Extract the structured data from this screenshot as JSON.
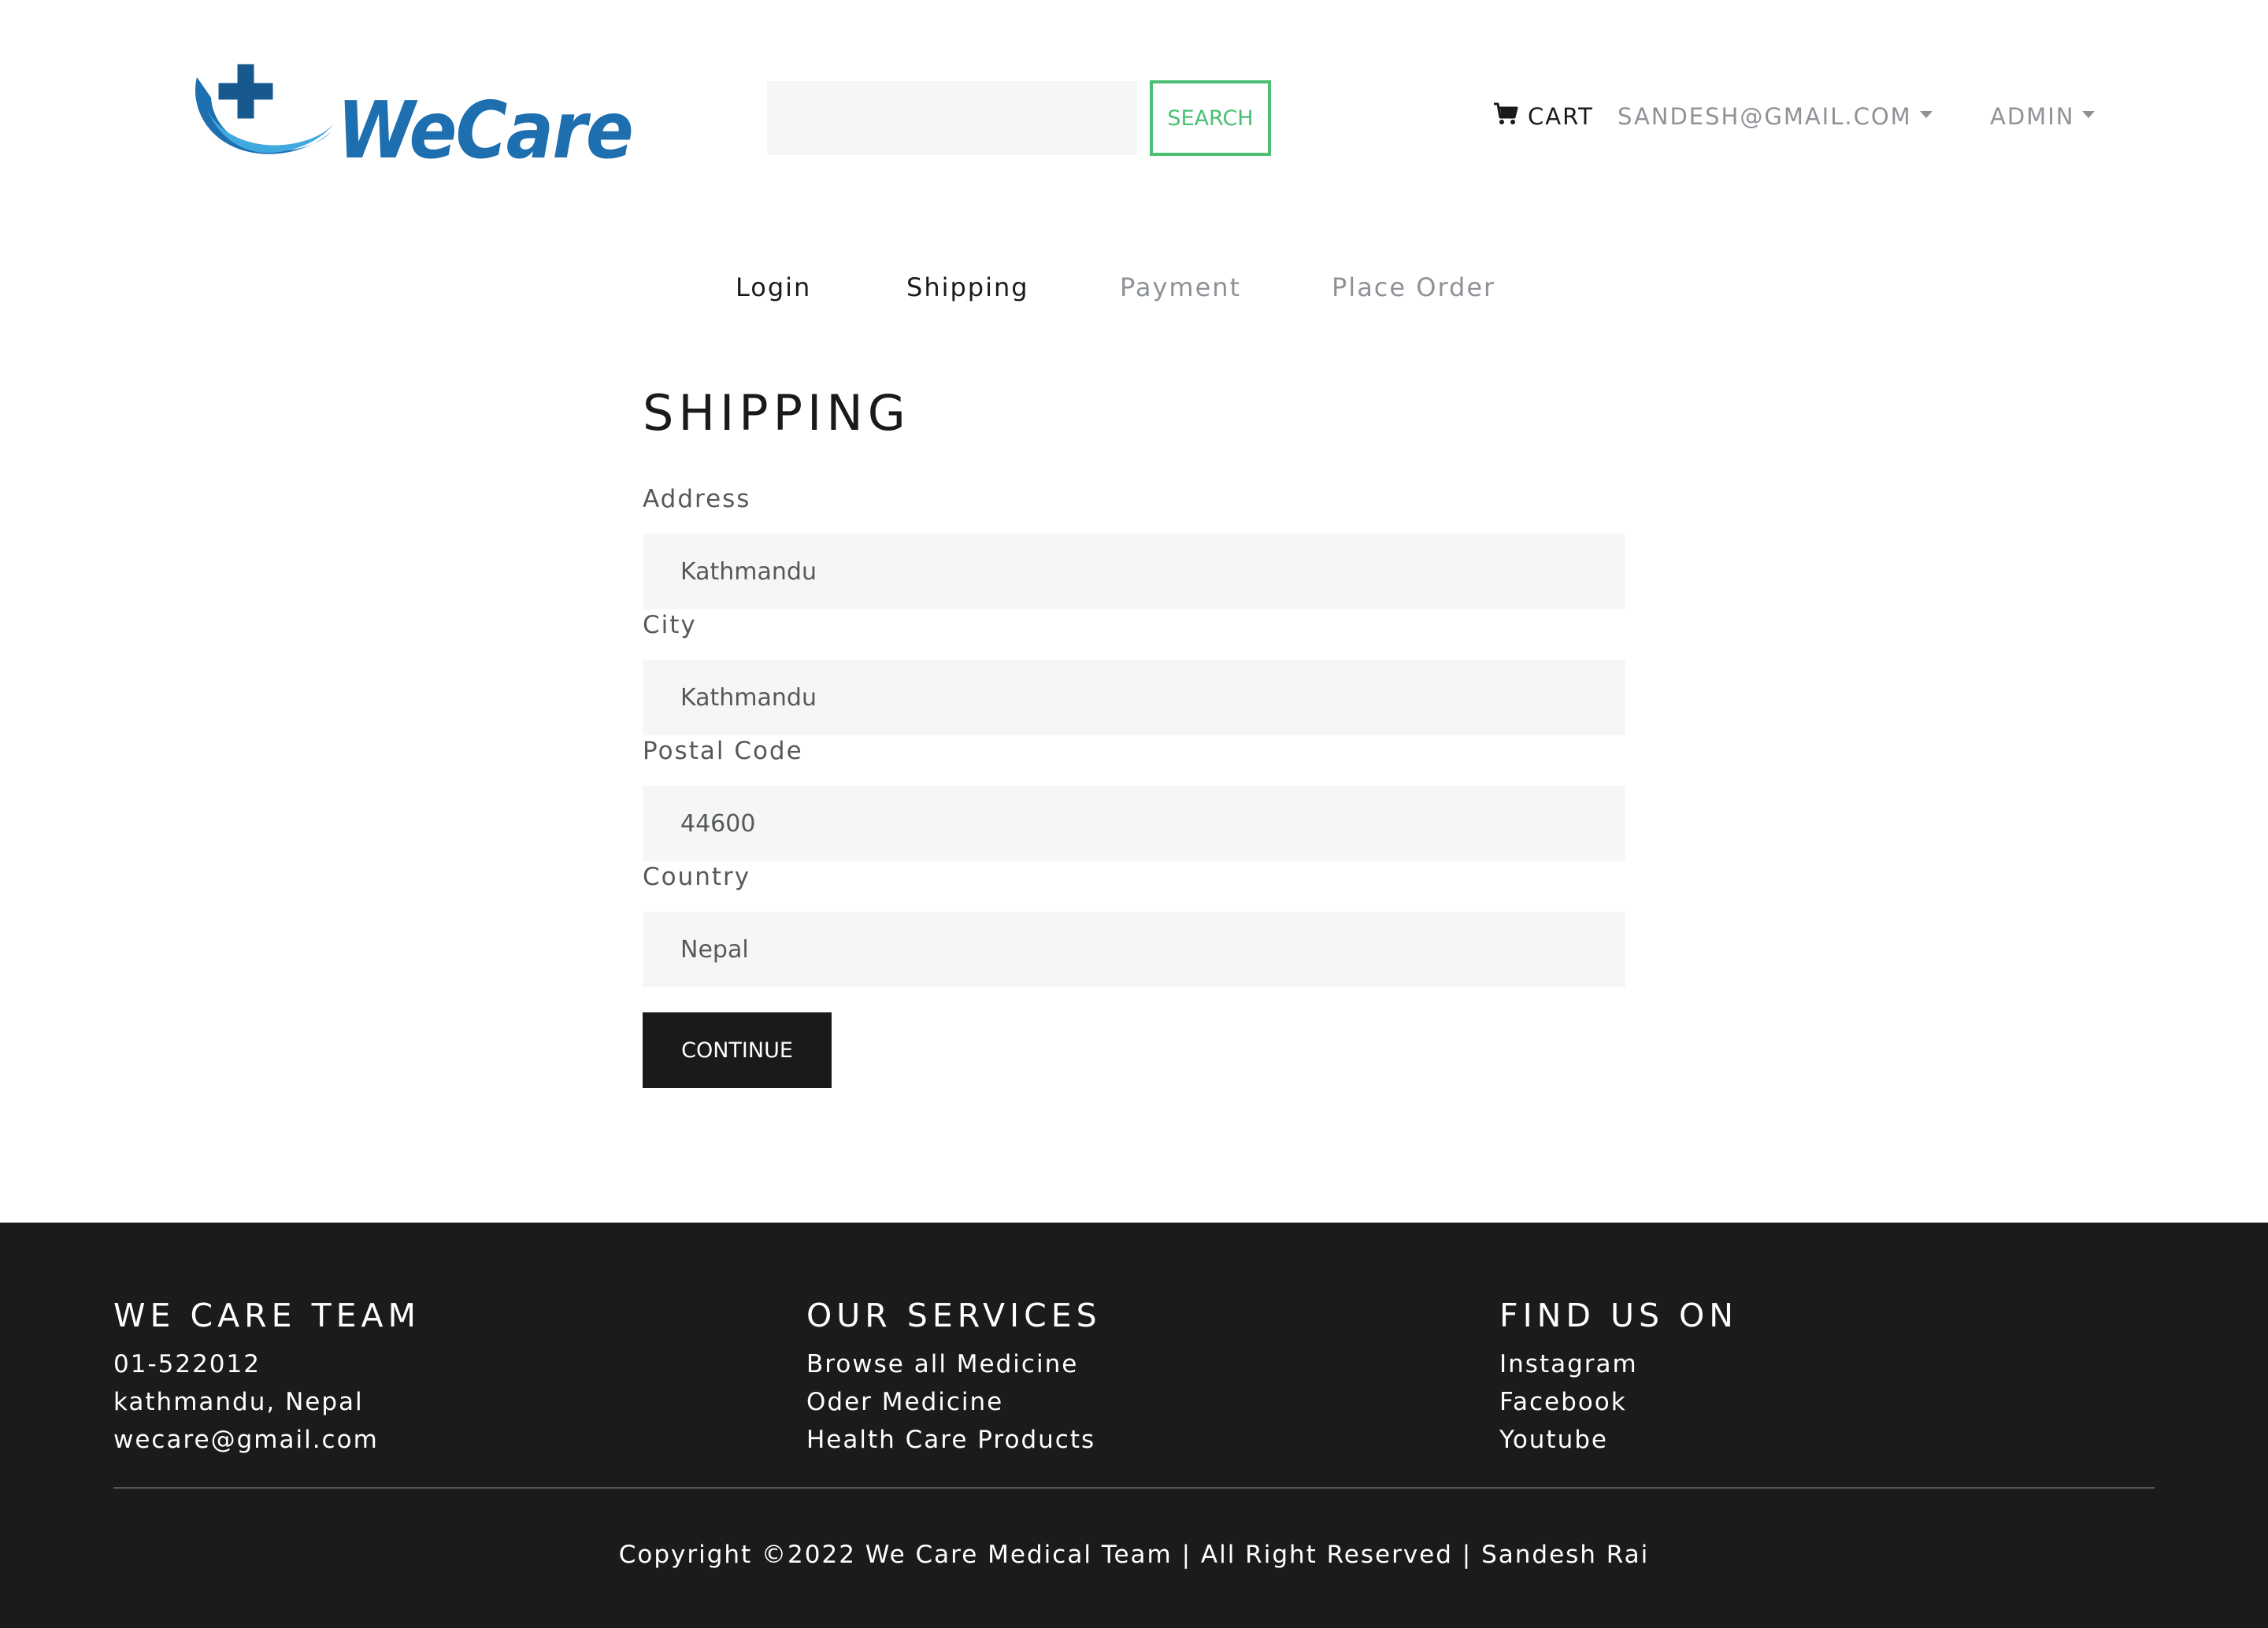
{
  "header": {
    "logo_text": "WeCare",
    "search": {
      "placeholder": "",
      "value": "",
      "button_label": "SEARCH"
    },
    "nav": {
      "cart_label": "CART",
      "user_label": "SANDESH@GMAIL.COM",
      "admin_label": "ADMIN"
    }
  },
  "steps": [
    {
      "label": "Login",
      "state": "active"
    },
    {
      "label": "Shipping",
      "state": "active"
    },
    {
      "label": "Payment",
      "state": "disabled"
    },
    {
      "label": "Place Order",
      "state": "disabled"
    }
  ],
  "form": {
    "title": "SHIPPING",
    "fields": [
      {
        "label": "Address",
        "value": "Kathmandu"
      },
      {
        "label": "City",
        "value": "Kathmandu"
      },
      {
        "label": "Postal Code",
        "value": "44600"
      },
      {
        "label": "Country",
        "value": "Nepal"
      }
    ],
    "submit_label": "CONTINUE"
  },
  "footer": {
    "columns": [
      {
        "heading": "WE CARE TEAM",
        "lines": [
          "01-522012",
          "kathmandu, Nepal",
          "wecare@gmail.com"
        ]
      },
      {
        "heading": "OUR SERVICES",
        "lines": [
          "Browse all Medicine",
          "Oder Medicine",
          "Health Care Products"
        ]
      },
      {
        "heading": "FIND US ON",
        "lines": [
          "Instagram",
          "Facebook",
          "Youtube"
        ]
      }
    ],
    "copyright": "Copyright ©2022 We Care Medical Team | All Right Reserved | Sandesh Rai"
  },
  "colors": {
    "brand_blue": "#1e6fb0",
    "brand_dark_blue": "#17598f",
    "search_accent": "#4bbf73",
    "dark": "#1a1a1a",
    "muted": "#8e9297",
    "input_bg": "#f6f6f7",
    "footer_bg": "#1b1b1b"
  },
  "icons": {
    "cart": "shopping-cart-icon",
    "user_dropdown": "chevron-down-icon",
    "admin_dropdown": "chevron-down-icon"
  }
}
